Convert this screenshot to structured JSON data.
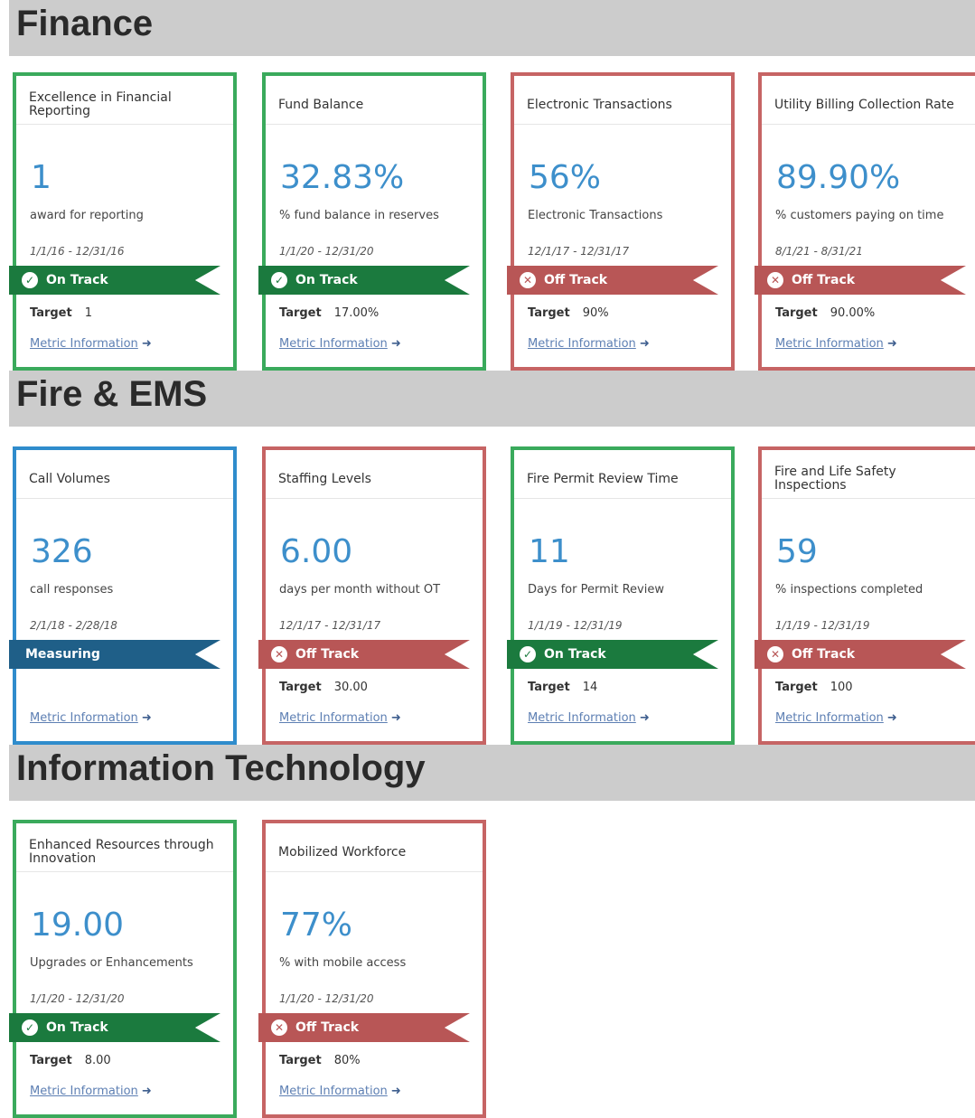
{
  "sections": [
    {
      "title": "Finance",
      "cards": [
        {
          "title": "Excellence in Financial Reporting",
          "value": "1",
          "description": "award for reporting",
          "date_range": "1/1/16 - 12/31/16",
          "status": "On Track",
          "target_label": "Target",
          "target": "1",
          "link": "Metric Information"
        },
        {
          "title": "Fund Balance",
          "value": "32.83%",
          "description": "% fund balance in reserves",
          "date_range": "1/1/20 - 12/31/20",
          "status": "On Track",
          "target_label": "Target",
          "target": "17.00%",
          "link": "Metric Information"
        },
        {
          "title": "Electronic Transactions",
          "value": "56%",
          "description": "Electronic Transactions",
          "date_range": "12/1/17 - 12/31/17",
          "status": "Off Track",
          "target_label": "Target",
          "target": "90%",
          "link": "Metric Information"
        },
        {
          "title": "Utility Billing Collection Rate",
          "value": "89.90%",
          "description": "% customers paying on time",
          "date_range": "8/1/21 - 8/31/21",
          "status": "Off Track",
          "target_label": "Target",
          "target": "90.00%",
          "link": "Metric Information"
        }
      ]
    },
    {
      "title": "Fire & EMS",
      "cards": [
        {
          "title": "Call Volumes",
          "value": "326",
          "description": "call responses",
          "date_range": "2/1/18 - 2/28/18",
          "status": "Measuring",
          "target_label": "",
          "target": "",
          "link": "Metric Information"
        },
        {
          "title": "Staffing Levels",
          "value": "6.00",
          "description": "days per month without OT",
          "date_range": "12/1/17 - 12/31/17",
          "status": "Off Track",
          "target_label": "Target",
          "target": "30.00",
          "link": "Metric Information"
        },
        {
          "title": "Fire Permit Review Time",
          "value": "11",
          "description": "Days for Permit Review",
          "date_range": "1/1/19 - 12/31/19",
          "status": "On Track",
          "target_label": "Target",
          "target": "14",
          "link": "Metric Information"
        },
        {
          "title": "Fire and Life Safety Inspections",
          "value": "59",
          "description": "% inspections completed",
          "date_range": "1/1/19 - 12/31/19",
          "status": "Off Track",
          "target_label": "Target",
          "target": "100",
          "link": "Metric Information"
        }
      ]
    },
    {
      "title": "Information Technology",
      "cards": [
        {
          "title": "Enhanced Resources through Innovation",
          "value": "19.00",
          "description": "Upgrades or Enhancements",
          "date_range": "1/1/20 - 12/31/20",
          "status": "On Track",
          "target_label": "Target",
          "target": "8.00",
          "link": "Metric Information"
        },
        {
          "title": "Mobilized Workforce",
          "value": "77%",
          "description": "% with mobile access",
          "date_range": "1/1/20 - 12/31/20",
          "status": "Off Track",
          "target_label": "Target",
          "target": "80%",
          "link": "Metric Information"
        }
      ]
    }
  ],
  "colors": {
    "on_track": "#1b7a3e",
    "off_track": "#b85656",
    "measuring": "#1f5f88",
    "value_blue": "#3d8fcb"
  },
  "icons": {
    "on_track": "check-circle-icon",
    "off_track": "x-circle-icon",
    "link": "arrow-right-icon"
  }
}
